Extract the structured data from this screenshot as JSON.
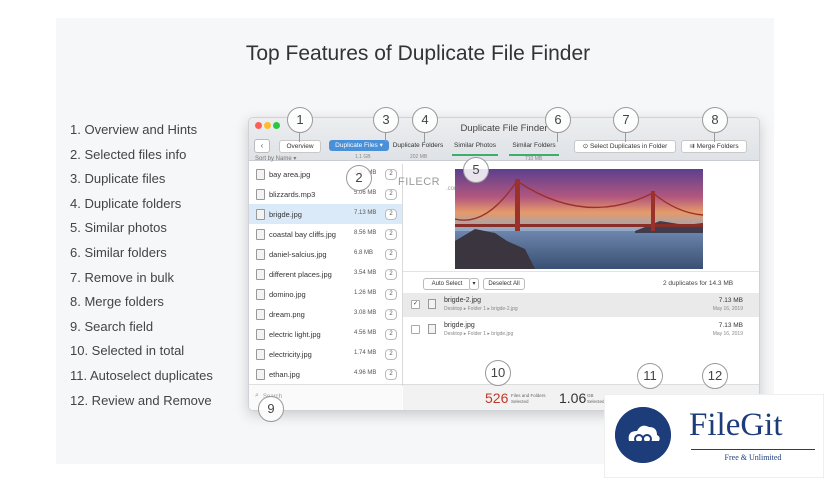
{
  "page_title": "Top Features of Duplicate File Finder",
  "features": [
    "1. Overview and Hints",
    "2. Selected files info",
    "3. Duplicate files",
    "4. Duplicate folders",
    "5. Similar photos",
    "6. Similar folders",
    "7. Remove in bulk",
    "8. Merge folders",
    "9. Search field",
    "10. Selected in total",
    "11. Autoselect duplicates",
    "12. Review and Remove"
  ],
  "window": {
    "title": "Duplicate File Finder",
    "back_label": "‹",
    "tabs": {
      "overview": "Overview",
      "duplicate_files": "Duplicate Files",
      "duplicate_folders": "Duplicate Folders",
      "similar_photos": "Similar Photos",
      "similar_folders": "Similar Folders",
      "select_duplicates": "Select Duplicates in Folder",
      "merge_folders": "Merge Folders"
    },
    "tab_sizes": {
      "duplicate_files": "1.1 GB",
      "duplicate_folders": "202 MB",
      "similar_folders": "710 MB"
    },
    "sort_label": "Sort by Name ▾",
    "files": [
      {
        "name": "bay area.jpg",
        "size": "2.47 MB",
        "count": "2"
      },
      {
        "name": "blizzards.mp3",
        "size": "5.06 MB",
        "count": "2"
      },
      {
        "name": "brigde.jpg",
        "size": "7.13 MB",
        "count": "2"
      },
      {
        "name": "coastal bay cliffs.jpg",
        "size": "8.56 MB",
        "count": "2"
      },
      {
        "name": "daniel-salcius.jpg",
        "size": "6.8 MB",
        "count": "2"
      },
      {
        "name": "different places.jpg",
        "size": "3.54 MB",
        "count": "2"
      },
      {
        "name": "domino.jpg",
        "size": "1.26 MB",
        "count": "2"
      },
      {
        "name": "dream.png",
        "size": "3.08 MB",
        "count": "2"
      },
      {
        "name": "electric light.jpg",
        "size": "4.56 MB",
        "count": "2"
      },
      {
        "name": "electricity.jpg",
        "size": "1.74 MB",
        "count": "2"
      },
      {
        "name": "ethan.jpg",
        "size": "4.96 MB",
        "count": "2"
      }
    ],
    "search_placeholder": "Search",
    "auto_select": "Auto Select",
    "auto_select_arrow": "▾",
    "deselect_all": "Deselect All",
    "duplicates_summary": "2 duplicates for 14.3 MB",
    "duplicates": [
      {
        "checked": "✓",
        "name": "brigde-2.jpg",
        "path": "Desktop ▸ Folder 1 ▸ brigde-2.jpg",
        "size": "7.13 MB",
        "date": "May 16, 2019"
      },
      {
        "checked": "",
        "name": "brigde.jpg",
        "path": "Desktop ▸ Folder 1 ▸ brigde.jpg",
        "size": "7.13 MB",
        "date": "May 16, 2019"
      }
    ],
    "status": {
      "files_count": "526",
      "files_label_1": "Files and Folders",
      "files_label_2": "Selected",
      "size_value": "1.06",
      "size_unit": "GB",
      "size_label": "Selected"
    }
  },
  "callouts": [
    "1",
    "2",
    "3",
    "4",
    "5",
    "6",
    "7",
    "8",
    "9",
    "10",
    "11",
    "12"
  ],
  "watermark": {
    "text": "FILECR",
    "sub": ".com"
  },
  "brand": {
    "name": "FileGit",
    "tagline": "Free & Unlimited"
  },
  "colors": {
    "accent": "#4a90d9",
    "selected_count": "#c0392b",
    "brand": "#1d3d7a",
    "tab_underline": "#3fae6a"
  }
}
